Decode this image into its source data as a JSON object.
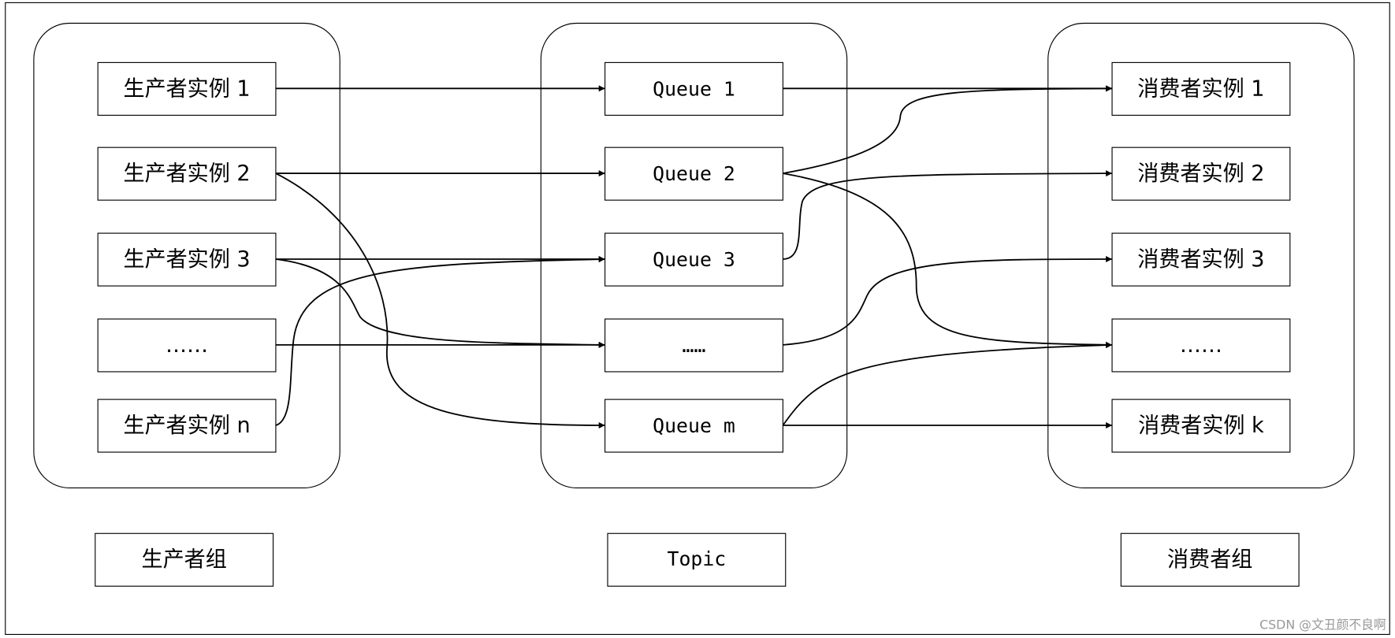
{
  "producers": [
    "生产者实例 1",
    "生产者实例 2",
    "生产者实例 3",
    "……",
    "生产者实例 n"
  ],
  "queues": [
    "Queue 1",
    "Queue 2",
    "Queue 3",
    "……",
    "Queue m"
  ],
  "consumers": [
    "消费者实例 1",
    "消费者实例 2",
    "消费者实例 3",
    "……",
    "消费者实例 k"
  ],
  "group_labels": {
    "producer_group": "生产者组",
    "topic": "Topic",
    "consumer_group": "消费者组"
  },
  "edges": [
    {
      "from": "producers.0",
      "to": "queues.0"
    },
    {
      "from": "producers.1",
      "to": "queues.1"
    },
    {
      "from": "producers.1",
      "to": "queues.4"
    },
    {
      "from": "producers.2",
      "to": "queues.2"
    },
    {
      "from": "producers.2",
      "to": "queues.3"
    },
    {
      "from": "producers.3",
      "to": "queues.3"
    },
    {
      "from": "producers.4",
      "to": "queues.2"
    },
    {
      "from": "queues.0",
      "to": "consumers.0"
    },
    {
      "from": "queues.1",
      "to": "consumers.0"
    },
    {
      "from": "queues.1",
      "to": "consumers.3"
    },
    {
      "from": "queues.2",
      "to": "consumers.1"
    },
    {
      "from": "queues.3",
      "to": "consumers.2"
    },
    {
      "from": "queues.4",
      "to": "consumers.3"
    },
    {
      "from": "queues.4",
      "to": "consumers.4"
    }
  ],
  "watermark": "CSDN @文丑颜不良啊"
}
